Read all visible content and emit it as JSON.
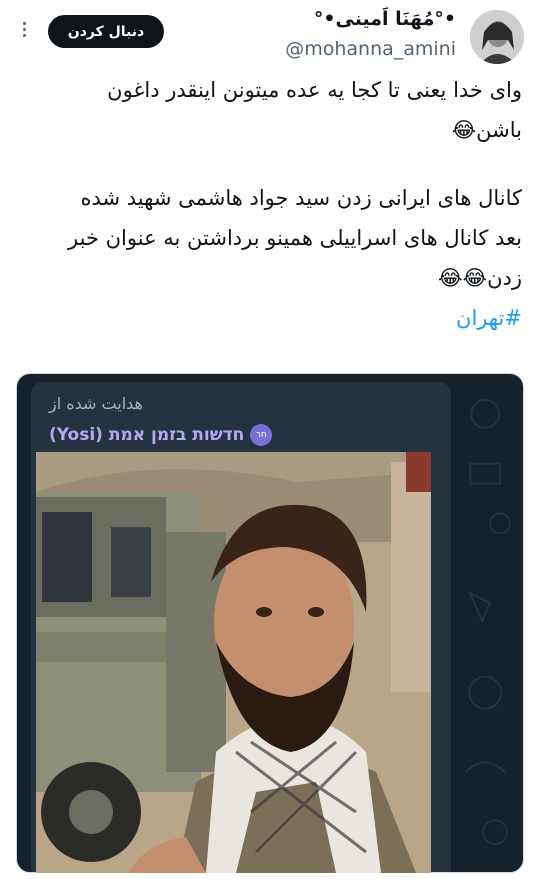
{
  "tweet": {
    "author": {
      "display_name": "•°مُهَنَا اَمینی•°",
      "handle": "@mohanna_amini"
    },
    "follow_label": "دنبال کردن",
    "text_lines": [
      "وای خدا یعنی تا کجا یه عده میتونن اینقدر داغون",
      "باشن😂",
      "",
      "کانال های ایرانی زدن سید جواد هاشمی شهید شده",
      "بعد کانال های اسراییلی همینو برداشتن به عنوان خبر",
      "زدن😂😂"
    ],
    "hashtag": "#تهران"
  },
  "media": {
    "forwarded_label": "هدایت شده از",
    "channel_badge": "חר",
    "channel_name": "חדשות בזמן אמת (Yosi)"
  },
  "colors": {
    "text": "#0f1419",
    "secondary": "#536471",
    "link": "#1d9bf0",
    "follow_bg": "#0f1419",
    "telegram_bg": "#17212b",
    "bubble_bg": "#253341",
    "channel_name": "#b9a7f5"
  },
  "icons": {
    "more": "more-icon",
    "avatar": "avatar"
  }
}
